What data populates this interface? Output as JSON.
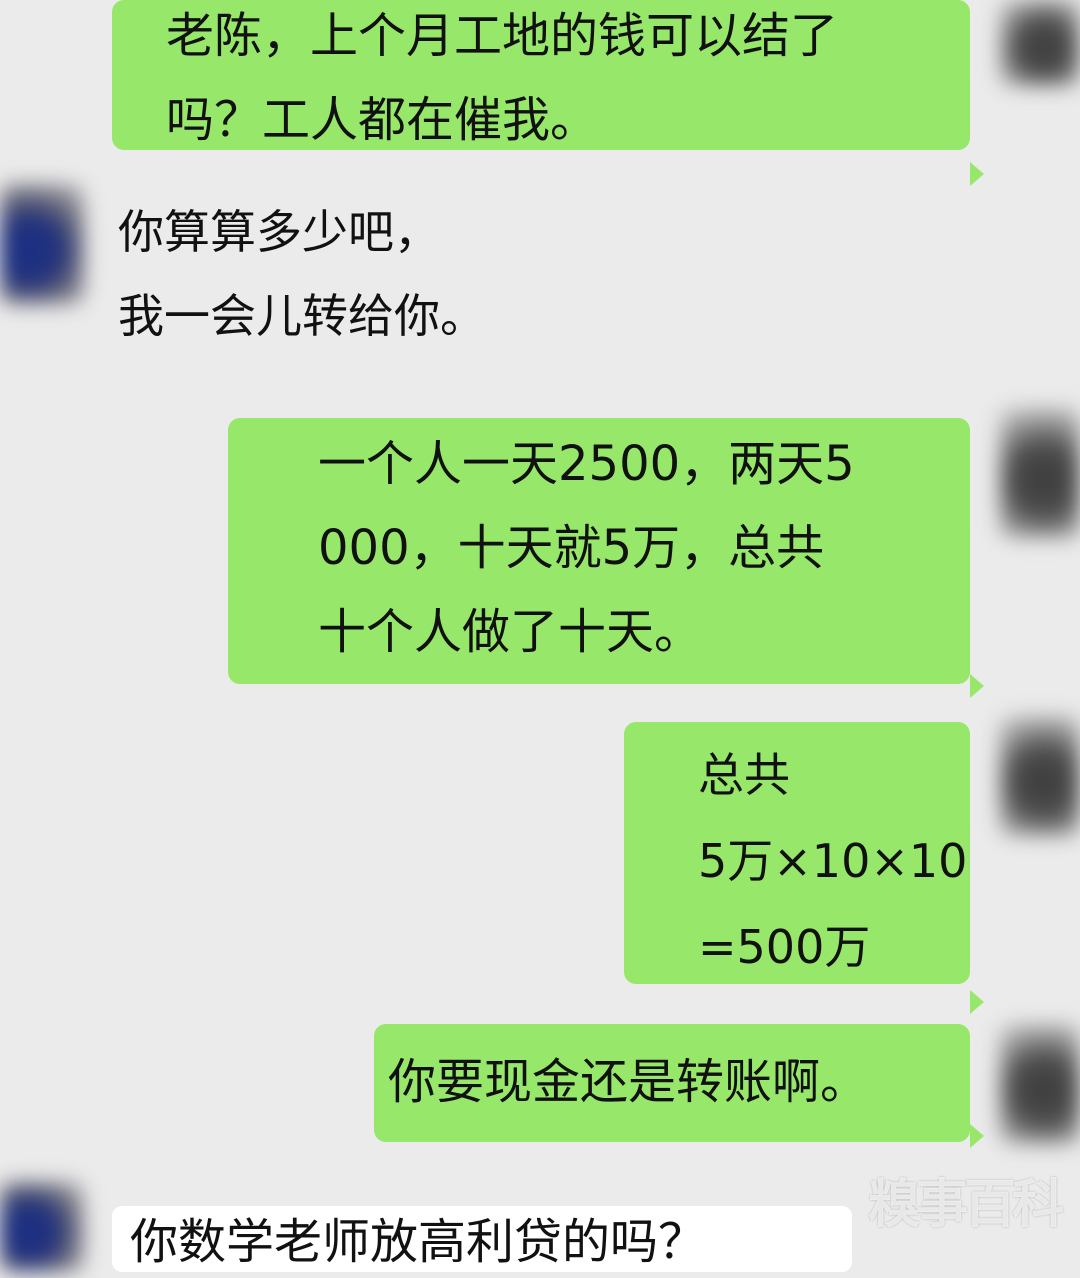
{
  "messages": [
    {
      "side": "sent",
      "text": "老陈，上个月工地的钱可以结了\n吗？工人都在催我。"
    },
    {
      "side": "received",
      "text": "你算算多少吧，\n我一会儿转给你。"
    },
    {
      "side": "sent",
      "text": "一个人一天2500，两天5\n000，十天就5万，总共\n十个人做了十天。"
    },
    {
      "side": "sent",
      "text": "总共\n5万×10×10\n=500万"
    },
    {
      "side": "sent",
      "text": "你要现金还是转账啊。"
    },
    {
      "side": "received",
      "text": "你数学老师放高利贷的吗？"
    }
  ],
  "watermark": "糗事百科",
  "colors": {
    "bubble_green": "#97e86a",
    "background": "#ebebeb",
    "bubble_white": "#ffffff"
  }
}
